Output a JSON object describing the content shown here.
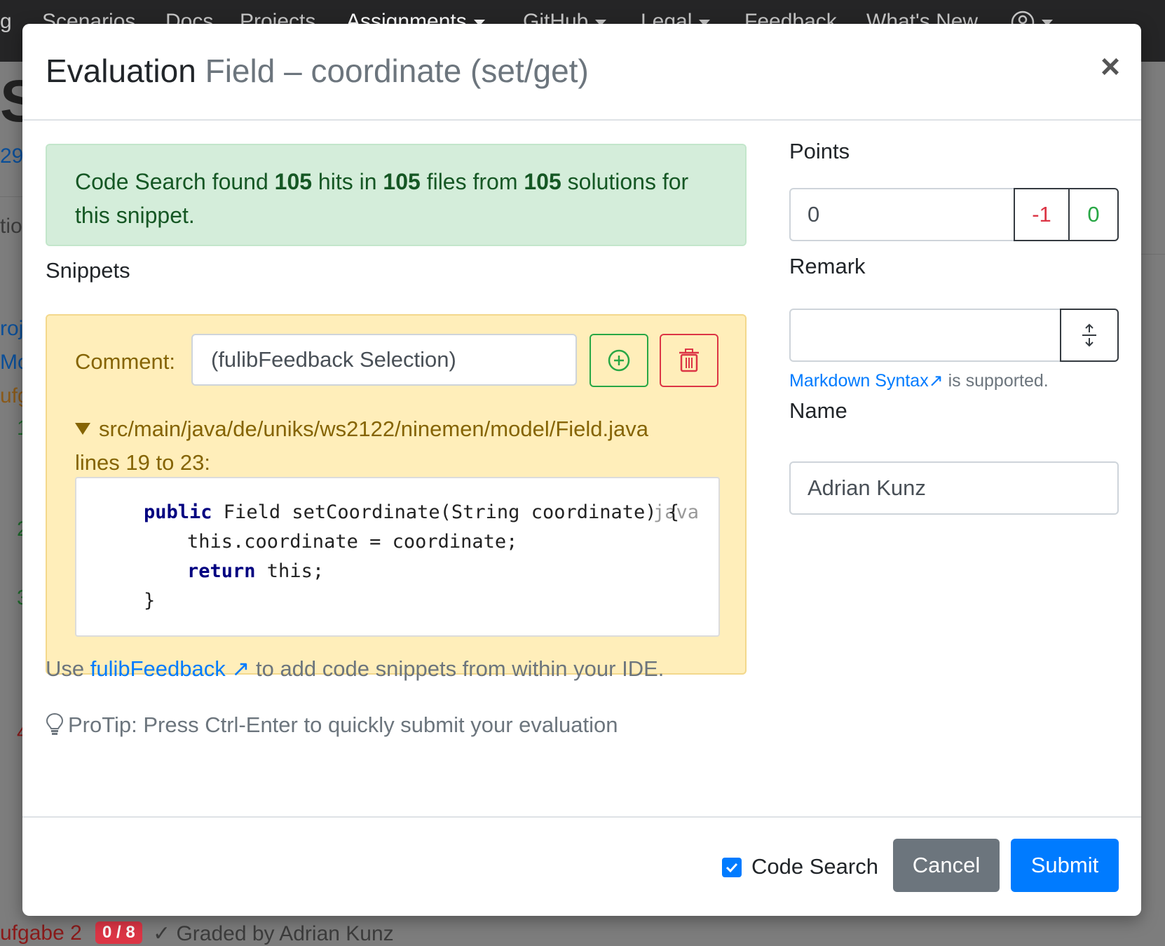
{
  "background": {
    "nav_items": [
      "g",
      "Scenarios",
      "Docs",
      "Projects",
      "Assignments",
      "GitHub",
      "Legal",
      "Feedback",
      "What's New"
    ],
    "heading_fragment": "S",
    "link_fragment": "29",
    "tab_fragment": "tio",
    "item_fragments": [
      "roj",
      "Mod",
      "ufg"
    ],
    "number_fragments": [
      "1",
      "2",
      "3",
      "4"
    ],
    "bottom_task": "ufgabe 2",
    "bottom_badge": "0 / 8",
    "bottom_status": "✓ Graded by Adrian Kunz"
  },
  "modal": {
    "title_prefix": "Evaluation",
    "title_name": "Field – coordinate (set/get)",
    "close_symbol": "×"
  },
  "alert": {
    "t1": "Code Search found ",
    "hits": "105",
    "t2": " hits in ",
    "files": "105",
    "t3": " files from ",
    "solutions": "105",
    "t4": " solutions for this snippet."
  },
  "snippets": {
    "label": "Snippets",
    "comment_label": "Comment:",
    "comment_value": "(fulibFeedback Selection)",
    "file": "src/main/java/de/uniks/ws2122/ninemen/model/Field.java",
    "lines": "lines 19 to 23:",
    "lang": "java",
    "code": {
      "l1_kw": "public",
      "l1_rest": " Field setCoordinate(String coordinate) {",
      "l2": "this.coordinate = coordinate;",
      "l3_kw": "return",
      "l3_rest": " this;",
      "l4": "}"
    }
  },
  "info": {
    "use_prefix": "Use ",
    "use_link": "fulibFeedback ↗",
    "use_suffix": " to add code snippets from within your IDE.",
    "protip": "ProTip: Press Ctrl-Enter to quickly submit your evaluation"
  },
  "points": {
    "label": "Points",
    "value": "0",
    "btn_minus": "-1",
    "btn_zero": "0"
  },
  "remark": {
    "label": "Remark",
    "value": "",
    "md_link": "Markdown Syntax↗",
    "md_suffix": " is supported."
  },
  "name": {
    "label": "Name",
    "value": "Adrian Kunz"
  },
  "footer": {
    "code_search_label": "Code Search",
    "code_search_checked": true,
    "cancel": "Cancel",
    "submit": "Submit"
  },
  "colors": {
    "primary": "#007bff",
    "success": "#28a745",
    "danger": "#dc3545",
    "secondary": "#6c757d",
    "warning_bg": "#ffeeba",
    "success_bg": "#d4edda"
  }
}
